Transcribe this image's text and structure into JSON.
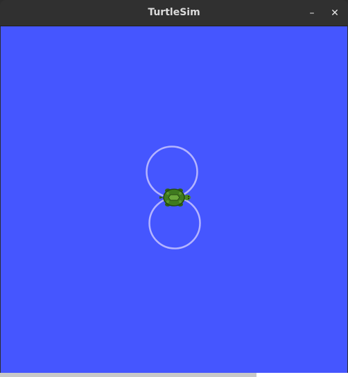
{
  "window": {
    "title": "TurtleSim",
    "minimize_label": "–",
    "close_label": "✕"
  },
  "canvas": {
    "background_color": "#4556ff",
    "trail_color": "#b4b4ff",
    "turtle_body_color": "#3f7a1f"
  }
}
